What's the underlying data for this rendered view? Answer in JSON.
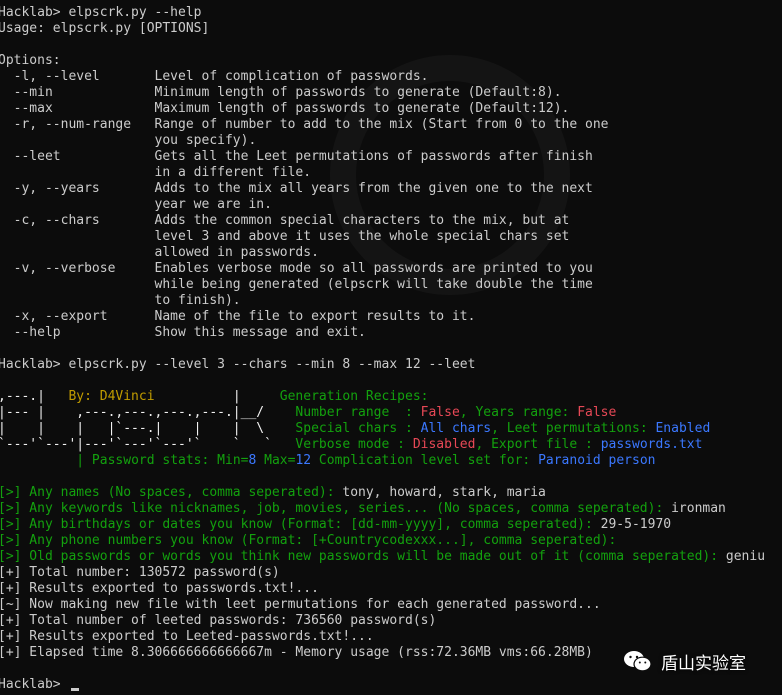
{
  "colors": {
    "background": "#0c0c0c",
    "default": "#cccccc",
    "yellow": "#c19c00",
    "green": "#13a10e",
    "red": "#e74856",
    "blue": "#3b78ff",
    "white": "#f2f2f2"
  },
  "lines": [
    [
      [
        "def",
        "Hacklab> elpscrk.py --help"
      ]
    ],
    [
      [
        "def",
        "Usage: elpscrk.py [OPTIONS]"
      ]
    ],
    [],
    [
      [
        "def",
        "Options:"
      ]
    ],
    [
      [
        "def",
        "  -l, --level       Level of complication of passwords."
      ]
    ],
    [
      [
        "def",
        "  --min             Minimum length of passwords to generate (Default:8)."
      ]
    ],
    [
      [
        "def",
        "  --max             Maximum length of passwords to generate (Default:12)."
      ]
    ],
    [
      [
        "def",
        "  -r, --num-range   Range of number to add to the mix (Start from 0 to the one"
      ]
    ],
    [
      [
        "def",
        "                    you specify)."
      ]
    ],
    [
      [
        "def",
        "  --leet            Gets all the Leet permutations of passwords after finish"
      ]
    ],
    [
      [
        "def",
        "                    in a different file."
      ]
    ],
    [
      [
        "def",
        "  -y, --years       Adds to the mix all years from the given one to the next"
      ]
    ],
    [
      [
        "def",
        "                    year we are in."
      ]
    ],
    [
      [
        "def",
        "  -c, --chars       Adds the common special characters to the mix, but at"
      ]
    ],
    [
      [
        "def",
        "                    level 3 and above it uses the whole special chars set"
      ]
    ],
    [
      [
        "def",
        "                    allowed in passwords."
      ]
    ],
    [
      [
        "def",
        "  -v, --verbose     Enables verbose mode so all passwords are printed to you"
      ]
    ],
    [
      [
        "def",
        "                    while being generated (elpscrk will take double the time"
      ]
    ],
    [
      [
        "def",
        "                    to finish)."
      ]
    ],
    [
      [
        "def",
        "  -x, --export      Name of the file to export results to it."
      ]
    ],
    [
      [
        "def",
        "  --help            Show this message and exit."
      ]
    ],
    [],
    [
      [
        "def",
        "Hacklab> elpscrk.py --level 3 --chars --min 8 --max 12 --leet"
      ]
    ],
    [],
    [
      [
        "w",
        ",---.|"
      ],
      [
        "y",
        "   By: D4Vinci          "
      ],
      [
        "w",
        "|"
      ],
      [
        "g",
        "     Generation Recipes:"
      ]
    ],
    [
      [
        "w",
        "|--- |    ,---.,---.,---.,---.|__/ "
      ],
      [
        "g",
        "   Number range  : "
      ],
      [
        "r",
        "False"
      ],
      [
        "g",
        ", Years range: "
      ],
      [
        "r",
        "False"
      ]
    ],
    [
      [
        "w",
        "|    |    |   |`---.|    |    |  \\ "
      ],
      [
        "g",
        "   Special chars : "
      ],
      [
        "b",
        "All chars"
      ],
      [
        "g",
        ", Leet permutations: "
      ],
      [
        "b",
        "Enabled"
      ]
    ],
    [
      [
        "w",
        "`---'`---'|---'`---'`---'`    `   `"
      ],
      [
        "g",
        "   Verbose mode : "
      ],
      [
        "r",
        "Disabled"
      ],
      [
        "g",
        ", Export file : "
      ],
      [
        "b",
        "passwords.txt"
      ]
    ],
    [
      [
        "w",
        "          "
      ],
      [
        "g",
        "| Password stats: Min="
      ],
      [
        "b",
        "8"
      ],
      [
        "g",
        " Max="
      ],
      [
        "b",
        "12"
      ],
      [
        "g",
        " Complication level set for: "
      ],
      [
        "b",
        "Paranoid person"
      ]
    ],
    [],
    [
      [
        "g",
        "[>] Any names (No spaces, comma seperated): "
      ],
      [
        "def",
        "tony, howard, stark, maria"
      ]
    ],
    [
      [
        "g",
        "[>] Any keywords like nicknames, job, movies, series... (No spaces, comma seperated): "
      ],
      [
        "def",
        "ironman"
      ]
    ],
    [
      [
        "g",
        "[>] Any birthdays or dates you know (Format: [dd-mm-yyyy], comma seperated): "
      ],
      [
        "def",
        "29-5-1970"
      ]
    ],
    [
      [
        "g",
        "[>] Any phone numbers you know (Format: [+Countrycodexxx...], comma seperated):"
      ]
    ],
    [
      [
        "g",
        "[>] Old passwords or words you think new passwords will be made out of it (comma seperated): "
      ],
      [
        "def",
        "geniu"
      ]
    ],
    [
      [
        "def",
        "[+] Total number: 130572 password(s)"
      ]
    ],
    [
      [
        "def",
        "[+] Results exported to passwords.txt!..."
      ]
    ],
    [
      [
        "def",
        "[~] Now making new file with leet permutations for each generated password..."
      ]
    ],
    [
      [
        "def",
        "[+] Total number of leeted passwords: 736560 password(s)"
      ]
    ],
    [
      [
        "def",
        "[+] Results exported to Leeted-passwords.txt!..."
      ]
    ],
    [
      [
        "def",
        "[+] Elapsed time 8.306666666666667m - Memory usage (rss:72.36MB vms:66.28MB)"
      ]
    ],
    [],
    [
      [
        "def",
        "Hacklab> "
      ]
    ]
  ],
  "watermark": {
    "label": "盾山实验室"
  }
}
